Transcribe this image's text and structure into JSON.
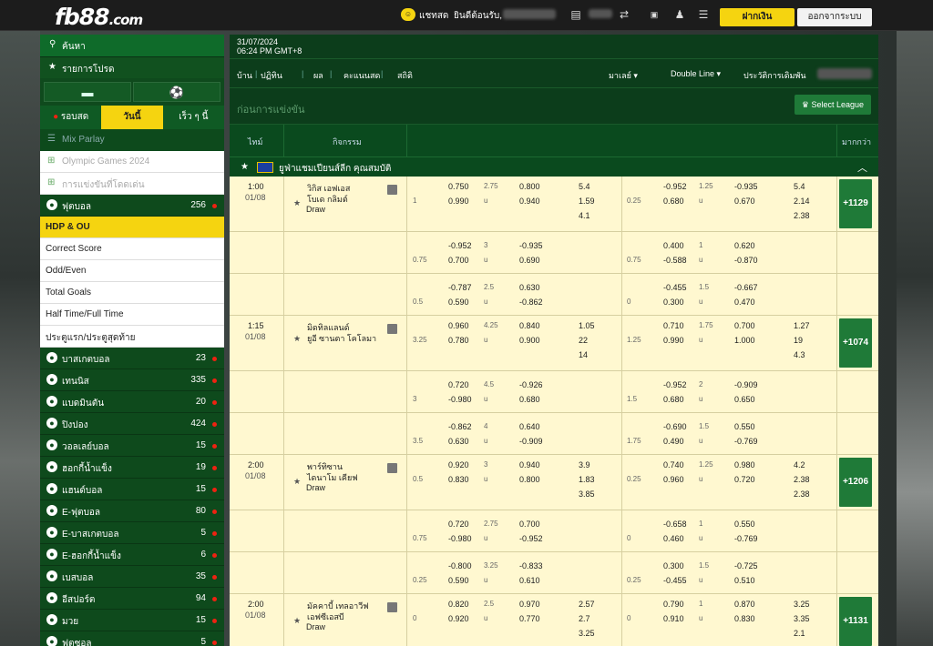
{
  "topbar": {
    "logo": "fb88",
    "logo_tld": ".com",
    "chat": "แชทสด",
    "welcome": "ยินดีต้อนรับ,",
    "deposit": "ฝากเงิน",
    "logout": "ออกจากระบบ"
  },
  "sidebar": {
    "search": "ค้นหา",
    "promo": "รายการโปรด",
    "tabs": [
      "รอบสด",
      "วันนี้",
      "เร็ว ๆ นี้"
    ],
    "mix": "Mix Parlay",
    "olympic": "Olympic Games 2024",
    "outright": "การแข่งขันที่โดดเด่น",
    "football": {
      "label": "ฟุตบอล",
      "count": "256"
    },
    "sub": [
      "HDP & OU",
      "Correct Score",
      "Odd/Even",
      "Total Goals",
      "Half Time/Full Time",
      "ประตูแรก/ประตูสุดท้าย"
    ],
    "sports": [
      {
        "label": "บาสเกตบอล",
        "count": "23"
      },
      {
        "label": "เทนนิส",
        "count": "335"
      },
      {
        "label": "แบดมินตัน",
        "count": "20"
      },
      {
        "label": "ปิงปอง",
        "count": "424"
      },
      {
        "label": "วอลเลย์บอล",
        "count": "15"
      },
      {
        "label": "ฮอกกี้น้ำแข็ง",
        "count": "19"
      },
      {
        "label": "แฮนด์บอล",
        "count": "15"
      },
      {
        "label": "E-ฟุตบอล",
        "count": "80"
      },
      {
        "label": "E-บาสเกตบอล",
        "count": "5"
      },
      {
        "label": "E-ฮอกกี้น้ำแข็ง",
        "count": "6"
      },
      {
        "label": "เบสบอล",
        "count": "35"
      },
      {
        "label": "อีสปอร์ต",
        "count": "94"
      },
      {
        "label": "มวย",
        "count": "15"
      },
      {
        "label": "ฟุตซอล",
        "count": "5"
      }
    ]
  },
  "main": {
    "date": "31/07/2024",
    "time": "06:24 PM GMT+8",
    "nav": [
      "บ้าน",
      "ปฏิทิน",
      "ผล",
      "คะแนนสด",
      "สถิติ"
    ],
    "odds_type": "มาเลย์",
    "line": "Double Line",
    "history": "ประวัติการเดิมพัน",
    "title": "ก่อนการแข่งขัน",
    "select_league": "Select League",
    "head": {
      "time": "ไทม์",
      "event": "กิจกรรม",
      "more": "มากกว่า"
    },
    "league": "ยูฟ่าแชมเปียนส์ลีก คุณสมบัติ",
    "matches": [
      {
        "time": "1:00",
        "date": "01/08",
        "home": "วิกิส เอฟเอส",
        "away": "โบเด กลิมต์",
        "draw": "Draw",
        "more": "+1129",
        "lines": [
          {
            "h1": "",
            "c1": [
              "0.750",
              "0.990"
            ],
            "g1": "2.75",
            "o1": [
              "0.800",
              "0.940"
            ],
            "x1": [
              "5.4",
              "1.59",
              "4.1"
            ],
            "h2": "0.25",
            "c2": [
              "-0.952",
              "0.680"
            ],
            "g2": "1.25",
            "o2": [
              "-0.935",
              "0.670"
            ],
            "x2": [
              "5.4",
              "2.14",
              "2.38"
            ],
            "hdp_side": "1"
          },
          {
            "h1": "0.75",
            "c1": [
              "-0.952",
              "0.700"
            ],
            "g1": "3",
            "o1": [
              "-0.935",
              "0.690"
            ],
            "h2": "0.75",
            "c2": [
              "0.400",
              "-0.588"
            ],
            "g2": "1",
            "o2": [
              "0.620",
              "-0.870"
            ]
          },
          {
            "h1": "0.5",
            "c1": [
              "-0.787",
              "0.590"
            ],
            "g1": "2.5",
            "o1": [
              "0.630",
              "-0.862"
            ],
            "h2": "0",
            "c2": [
              "-0.455",
              "0.300"
            ],
            "g2": "1.5",
            "o2": [
              "-0.667",
              "0.470"
            ]
          }
        ]
      },
      {
        "time": "1:15",
        "date": "01/08",
        "home": "มิดทิลแลนด์",
        "away": "ยูอี ซานตา โคโลมา",
        "draw": "",
        "more": "+1074",
        "lines": [
          {
            "h1": "3.25",
            "c1": [
              "0.960",
              "0.780"
            ],
            "g1": "4.25",
            "o1": [
              "0.840",
              "0.900"
            ],
            "x1": [
              "1.05",
              "22",
              "14"
            ],
            "h2": "1.25",
            "c2": [
              "0.710",
              "0.990"
            ],
            "g2": "1.75",
            "o2": [
              "0.700",
              "1.000"
            ],
            "x2": [
              "1.27",
              "19",
              "4.3"
            ]
          },
          {
            "h1": "3",
            "c1": [
              "0.720",
              "-0.980"
            ],
            "g1": "4.5",
            "o1": [
              "-0.926",
              "0.680"
            ],
            "h2": "1.5",
            "c2": [
              "-0.952",
              "0.680"
            ],
            "g2": "2",
            "o2": [
              "-0.909",
              "0.650"
            ]
          },
          {
            "h1": "3.5",
            "c1": [
              "-0.862",
              "0.630"
            ],
            "g1": "4",
            "o1": [
              "0.640",
              "-0.909"
            ],
            "h2": "1.75",
            "c2": [
              "-0.690",
              "0.490"
            ],
            "g2": "1.5",
            "o2": [
              "0.550",
              "-0.769"
            ]
          }
        ]
      },
      {
        "time": "2:00",
        "date": "01/08",
        "home": "พาร์ทิซาน",
        "away": "ไดนาโม เคียฟ",
        "draw": "Draw",
        "more": "+1206",
        "lines": [
          {
            "h1": "0.5",
            "c1": [
              "0.920",
              "0.830"
            ],
            "g1": "3",
            "o1": [
              "0.940",
              "0.800"
            ],
            "x1": [
              "3.9",
              "1.83",
              "3.85"
            ],
            "h2": "0.25",
            "c2": [
              "0.740",
              "0.960"
            ],
            "g2": "1.25",
            "o2": [
              "0.980",
              "0.720"
            ],
            "x2": [
              "4.2",
              "2.38",
              "2.38"
            ]
          },
          {
            "h1": "0.75",
            "c1": [
              "0.720",
              "-0.980"
            ],
            "g1": "2.75",
            "o1": [
              "0.700",
              "-0.952"
            ],
            "h2": "0",
            "c2": [
              "-0.658",
              "0.460"
            ],
            "g2": "1",
            "o2": [
              "0.550",
              "-0.769"
            ]
          },
          {
            "h1": "0.25",
            "c1": [
              "-0.800",
              "0.590"
            ],
            "g1": "3.25",
            "o1": [
              "-0.833",
              "0.610"
            ],
            "h2": "0.25",
            "c2": [
              "0.300",
              "-0.455"
            ],
            "g2": "1.5",
            "o2": [
              "-0.725",
              "0.510"
            ]
          }
        ]
      },
      {
        "time": "2:00",
        "date": "01/08",
        "home": "มัคคาบี้ เทลอาวีฟ",
        "away": "เอฟซีเอสบี",
        "draw": "Draw",
        "more": "+1131",
        "lines": [
          {
            "h1": "0",
            "c1": [
              "0.820",
              "0.920"
            ],
            "g1": "2.5",
            "o1": [
              "0.970",
              "0.770"
            ],
            "x1": [
              "2.57",
              "2.7",
              "3.25"
            ],
            "h2": "0",
            "c2": [
              "0.790",
              "0.910"
            ],
            "g2": "1",
            "o2": [
              "0.870",
              "0.830"
            ],
            "x2": [
              "3.25",
              "3.35",
              "2.1"
            ]
          }
        ]
      }
    ]
  }
}
